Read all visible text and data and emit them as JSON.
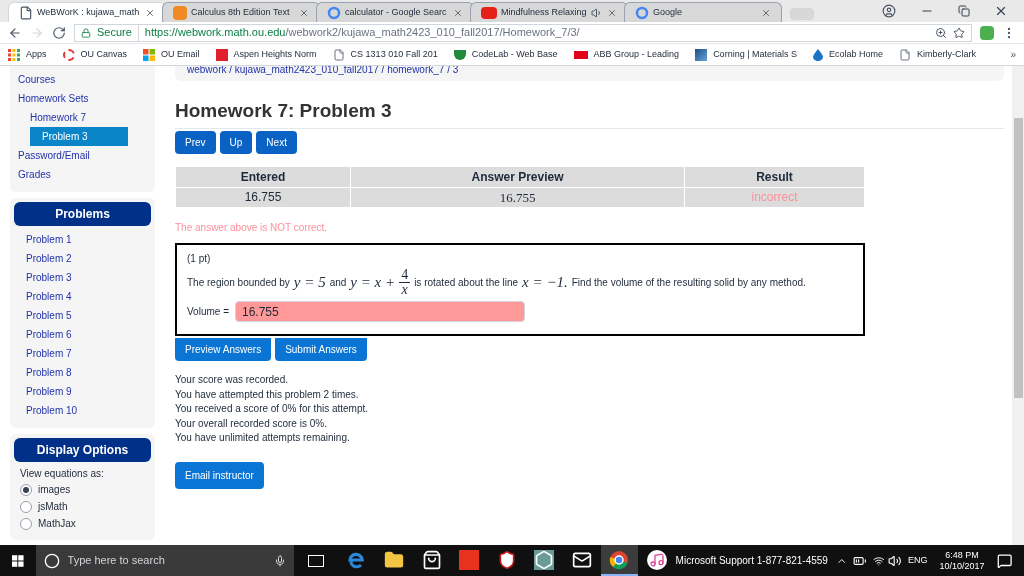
{
  "browser": {
    "tabs": [
      {
        "title": "WeBWorK : kujawa_math",
        "selected": true,
        "audio": false
      },
      {
        "title": "Calculus 8th Edition Text",
        "selected": false,
        "audio": false
      },
      {
        "title": "calculator - Google Searc",
        "selected": false,
        "audio": false
      },
      {
        "title": "Mindfulness Relaxing",
        "selected": false,
        "audio": true
      },
      {
        "title": "Google",
        "selected": false,
        "audio": false
      }
    ],
    "secure_label": "Secure",
    "url_host": "https://webwork.math.ou.edu",
    "url_path": "/webwork2/kujawa_math2423_010_fall2017/Homework_7/3/",
    "bookmarks": [
      "Apps",
      "OU Canvas",
      "OU Email",
      "Aspen Heights Norm",
      "CS 1313 010 Fall 201",
      "CodeLab - Web Base",
      "ABB Group - Leading",
      "Corning | Materials S",
      "Ecolab Home",
      "Kimberly-Clark"
    ],
    "more_bookmarks": "»"
  },
  "sidebar": {
    "menu": [
      {
        "label": "Courses",
        "selected": false
      },
      {
        "label": "Homework Sets",
        "selected": false,
        "children": [
          {
            "label": "Homework 7",
            "selected": false,
            "children": [
              {
                "label": "Problem 3",
                "selected": true
              }
            ]
          }
        ]
      },
      {
        "label": "Password/Email",
        "selected": false
      },
      {
        "label": "Grades",
        "selected": false
      }
    ],
    "problems_title": "Problems",
    "problems": [
      "Problem 1",
      "Problem 2",
      "Problem 3",
      "Problem 4",
      "Problem 5",
      "Problem 6",
      "Problem 7",
      "Problem 8",
      "Problem 9",
      "Problem 10"
    ],
    "display_title": "Display Options",
    "display_label": "View equations as:",
    "display_options": [
      {
        "label": "images",
        "selected": true
      },
      {
        "label": "jsMath",
        "selected": false
      },
      {
        "label": "MathJax",
        "selected": false
      }
    ]
  },
  "breadcrumb": "webwork / kujawa_math2423_010_fall2017 / homework_7 / 3",
  "title": "Homework 7: Problem 3",
  "nav_buttons": [
    "Prev",
    "Up",
    "Next"
  ],
  "results": {
    "columns": [
      "Entered",
      "Answer Preview",
      "Result"
    ],
    "rows": [
      {
        "entered": "16.755",
        "preview": "16.755",
        "result": "incorrect",
        "correct": false
      }
    ]
  },
  "message": "The answer above is NOT correct.",
  "problem": {
    "points": "(1 pt)",
    "statement": [
      {
        "kind": "text",
        "text": "The region bounded by"
      },
      {
        "kind": "math",
        "text": "y = 5"
      },
      {
        "kind": "text",
        "text": "and"
      },
      {
        "kind": "math",
        "text": "y = x +"
      },
      {
        "kind": "fraction",
        "numerator": "4",
        "denominator": "x"
      },
      {
        "kind": "text",
        "text": "is rotated about the line"
      },
      {
        "kind": "math",
        "text": "x = −1."
      },
      {
        "kind": "text",
        "text": "Find the volume of the resulting solid by any method."
      }
    ],
    "answer_label": "Volume =",
    "answer_value": "16.755",
    "answer_correct": false
  },
  "action_buttons": [
    "Preview Answers",
    "Submit Answers"
  ],
  "status_lines": [
    "Your score was recorded.",
    "You have attempted this problem 2 times.",
    "You received a score of 0% for this attempt.",
    "Your overall recorded score is 0%.",
    "You have unlimited attempts remaining."
  ],
  "email_button": "Email instructor",
  "taskbar": {
    "search_placeholder": "Type here to search",
    "apps": [
      {
        "selected": false
      },
      {
        "selected": false
      },
      {
        "selected": false
      },
      {
        "selected": false
      },
      {
        "selected": false
      },
      {
        "selected": false
      },
      {
        "selected": false
      },
      {
        "selected": true
      },
      {
        "selected": false
      }
    ],
    "notice": "Microsoft Support 1-877-821-4559",
    "language": "ENG",
    "time": "6:48 PM",
    "date": "10/10/2017"
  }
}
